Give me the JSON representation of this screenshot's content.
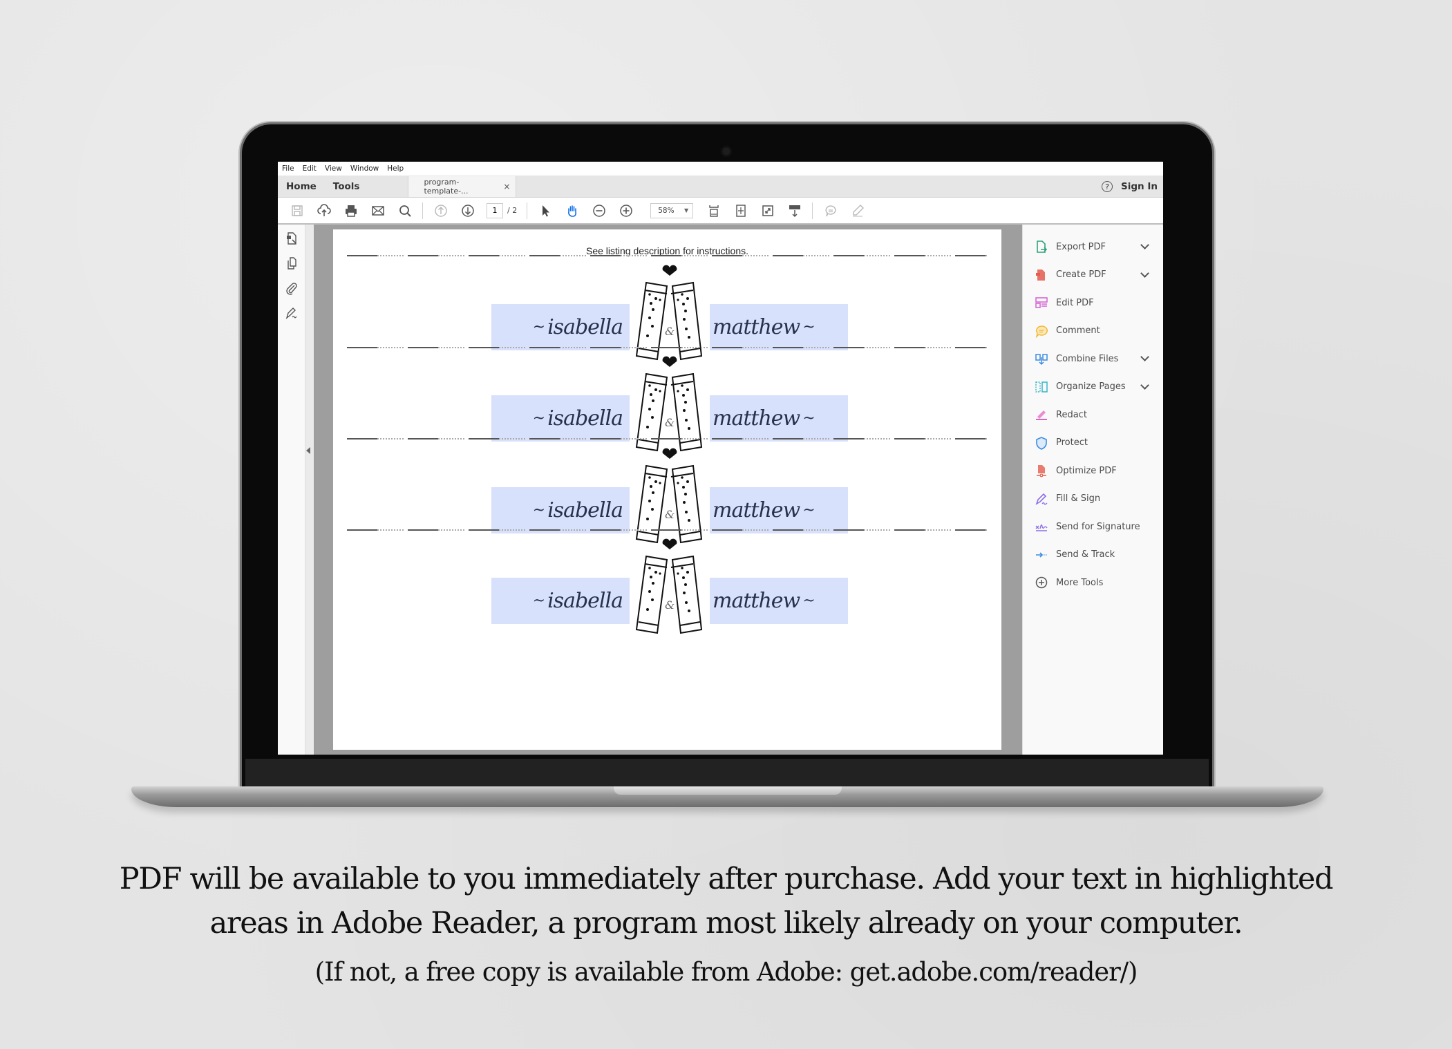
{
  "menubar": {
    "items": [
      "File",
      "Edit",
      "View",
      "Window",
      "Help"
    ]
  },
  "tabbar": {
    "home": "Home",
    "tools": "Tools",
    "document_tab": "program-template-...",
    "close_symbol": "×",
    "help_symbol": "?",
    "sign_in": "Sign In"
  },
  "toolbar": {
    "icons": [
      "save-icon",
      "upload-cloud-icon",
      "print-icon",
      "email-icon",
      "search-icon",
      "page-up-icon",
      "page-down-icon",
      "select-cursor-icon",
      "hand-tool-icon",
      "zoom-out-icon",
      "zoom-in-icon",
      "fit-width-icon",
      "fit-page-icon",
      "full-screen-icon",
      "scroll-mode-icon",
      "comment-icon",
      "highlight-pen-icon"
    ],
    "current_page": "1",
    "total_pages": "/ 2",
    "zoom": "58%",
    "active_tool": "hand-tool",
    "active_color": "#1473e6"
  },
  "left_rail": {
    "icons": [
      "page-thumbnails-icon",
      "copy-pages-icon",
      "attachments-icon",
      "signature-pen-icon"
    ]
  },
  "document": {
    "instructions": "See listing description for instructions.",
    "highlight_color": "#d8e1fb",
    "labels": [
      {
        "left_name": "isabella",
        "right_name": "matthew",
        "ampersand": "&"
      },
      {
        "left_name": "isabella",
        "right_name": "matthew",
        "ampersand": "&"
      },
      {
        "left_name": "isabella",
        "right_name": "matthew",
        "ampersand": "&"
      },
      {
        "left_name": "isabella",
        "right_name": "matthew",
        "ampersand": "&"
      }
    ]
  },
  "right_panel": {
    "tools": [
      {
        "label": "Export PDF",
        "icon": "export-pdf-icon",
        "color": "#2ea37c",
        "has_dropdown": true
      },
      {
        "label": "Create PDF",
        "icon": "create-pdf-icon",
        "color": "#e45c4f",
        "has_dropdown": true
      },
      {
        "label": "Edit PDF",
        "icon": "edit-pdf-icon",
        "color": "#d45fd4",
        "has_dropdown": false
      },
      {
        "label": "Comment",
        "icon": "comment-icon",
        "color": "#f0b93a",
        "has_dropdown": false
      },
      {
        "label": "Combine Files",
        "icon": "combine-files-icon",
        "color": "#3a8be0",
        "has_dropdown": true
      },
      {
        "label": "Organize Pages",
        "icon": "organize-pages-icon",
        "color": "#36b5c9",
        "has_dropdown": true
      },
      {
        "label": "Redact",
        "icon": "redact-icon",
        "color": "#e35fc4",
        "has_dropdown": false
      },
      {
        "label": "Protect",
        "icon": "protect-shield-icon",
        "color": "#3d8ee0",
        "has_dropdown": false
      },
      {
        "label": "Optimize PDF",
        "icon": "optimize-pdf-icon",
        "color": "#e45c4f",
        "has_dropdown": false
      },
      {
        "label": "Fill & Sign",
        "icon": "fill-sign-icon",
        "color": "#8c6ee8",
        "has_dropdown": false
      },
      {
        "label": "Send for Signature",
        "icon": "send-signature-icon",
        "color": "#8c6ee8",
        "has_dropdown": false
      },
      {
        "label": "Send & Track",
        "icon": "send-track-icon",
        "color": "#3a8be0",
        "has_dropdown": false
      },
      {
        "label": "More Tools",
        "icon": "more-tools-plus-icon",
        "color": "#555555",
        "has_dropdown": false
      }
    ]
  },
  "caption": {
    "line1": "PDF will be available to you immediately after purchase.  Add your text in highlighted",
    "line2": "areas in Adobe Reader, a program most likely already on your computer.",
    "line3": "(If not, a free copy is available from Adobe: get.adobe.com/reader/)"
  }
}
